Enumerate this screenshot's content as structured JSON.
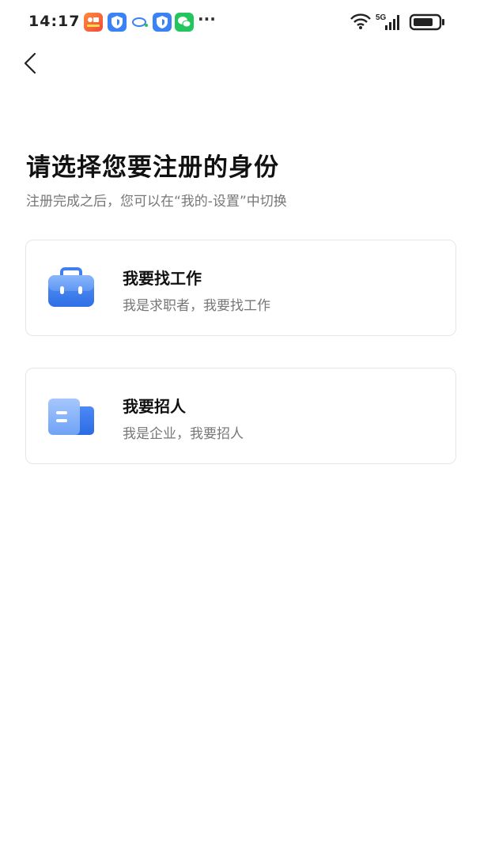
{
  "status_bar": {
    "time": "14:17",
    "network": "5G",
    "more_glyph": "···",
    "notification_icons": [
      "taobao-app-icon",
      "shield-app-icon",
      "chat-bubble-icon",
      "shield-app-icon",
      "wechat-icon"
    ]
  },
  "header": {
    "back_icon": "chevron-left-icon"
  },
  "main": {
    "title": "请选择您要注册的身份",
    "subtitle": "注册完成之后，您可以在“我的-设置”中切换",
    "cards": [
      {
        "title": "我要找工作",
        "description": "我是求职者，我要找工作",
        "icon": "briefcase-icon"
      },
      {
        "title": "我要招人",
        "description": "我是企业，我要招人",
        "icon": "company-building-icon"
      }
    ]
  },
  "colors": {
    "accent_blue": "#3f7fef",
    "light_blue": "#8ab6fb",
    "subtitle_gray": "#777777"
  }
}
